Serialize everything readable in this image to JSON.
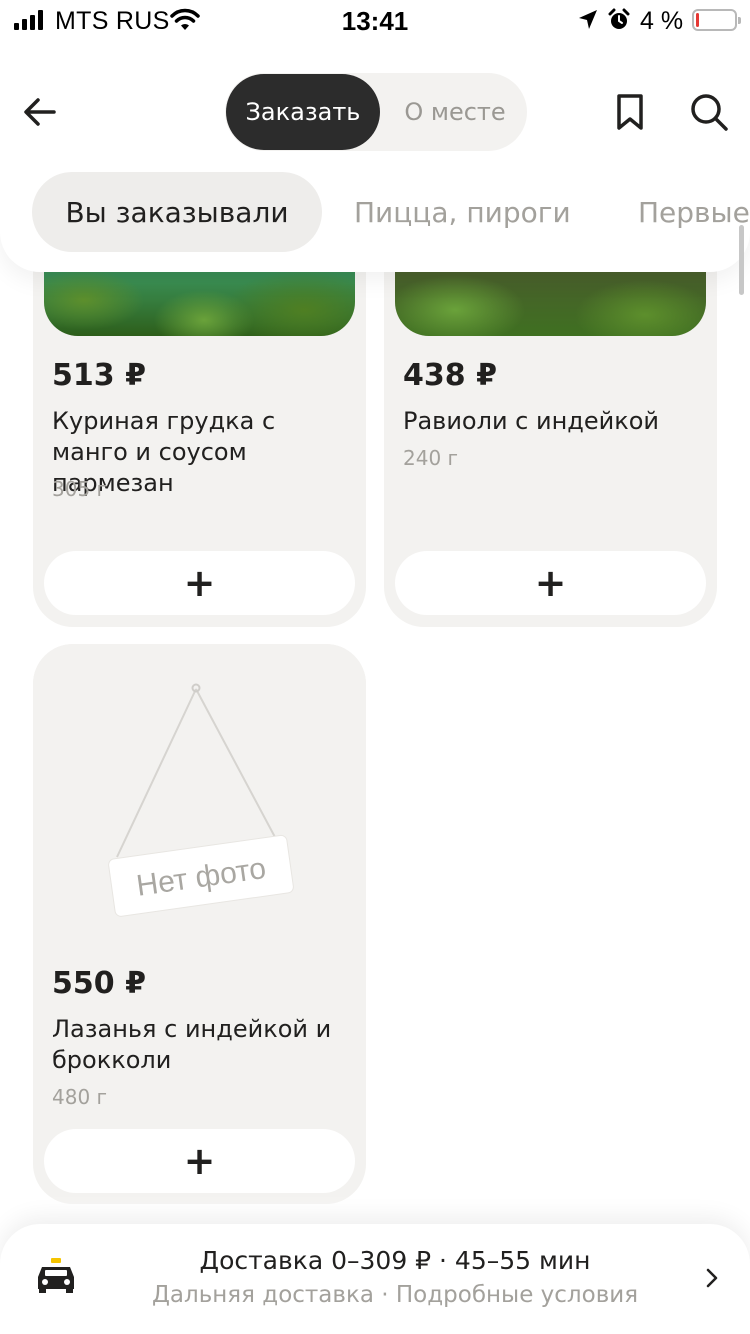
{
  "status_bar": {
    "carrier": "MTS RUS",
    "time": "13:41",
    "battery": "4 %"
  },
  "header": {
    "tabs": [
      {
        "label": "Заказать",
        "active": true
      },
      {
        "label": "О месте",
        "active": false
      }
    ],
    "icons": [
      "back-arrow-icon",
      "bookmark-icon",
      "search-icon"
    ]
  },
  "categories": [
    {
      "label": "Вы заказывали",
      "active": true
    },
    {
      "label": "Пицца, пироги",
      "active": false
    },
    {
      "label": "Первые",
      "active": false
    }
  ],
  "products": [
    {
      "price": "513 ₽",
      "name": "Куриная грудка с манго и соусом пармезан",
      "weight": "305 г",
      "add_label": "+"
    },
    {
      "price": "438 ₽",
      "name": "Равиоли с индейкой",
      "weight": "240 г",
      "add_label": "+"
    },
    {
      "price": "550 ₽",
      "name": "Лазанья с индейкой и брокколи",
      "weight": "480 г",
      "add_label": "+",
      "placeholder": "Нет фото"
    }
  ],
  "delivery": {
    "main": "Доставка 0–309 ₽ · 45–55 мин",
    "sub": "Дальняя доставка · Подробные условия"
  },
  "colors": {
    "accent_dark": "#2c2c2c",
    "card_bg": "#f3f2f0",
    "muted_text": "#a3a19c",
    "battery_low": "#e53935"
  }
}
